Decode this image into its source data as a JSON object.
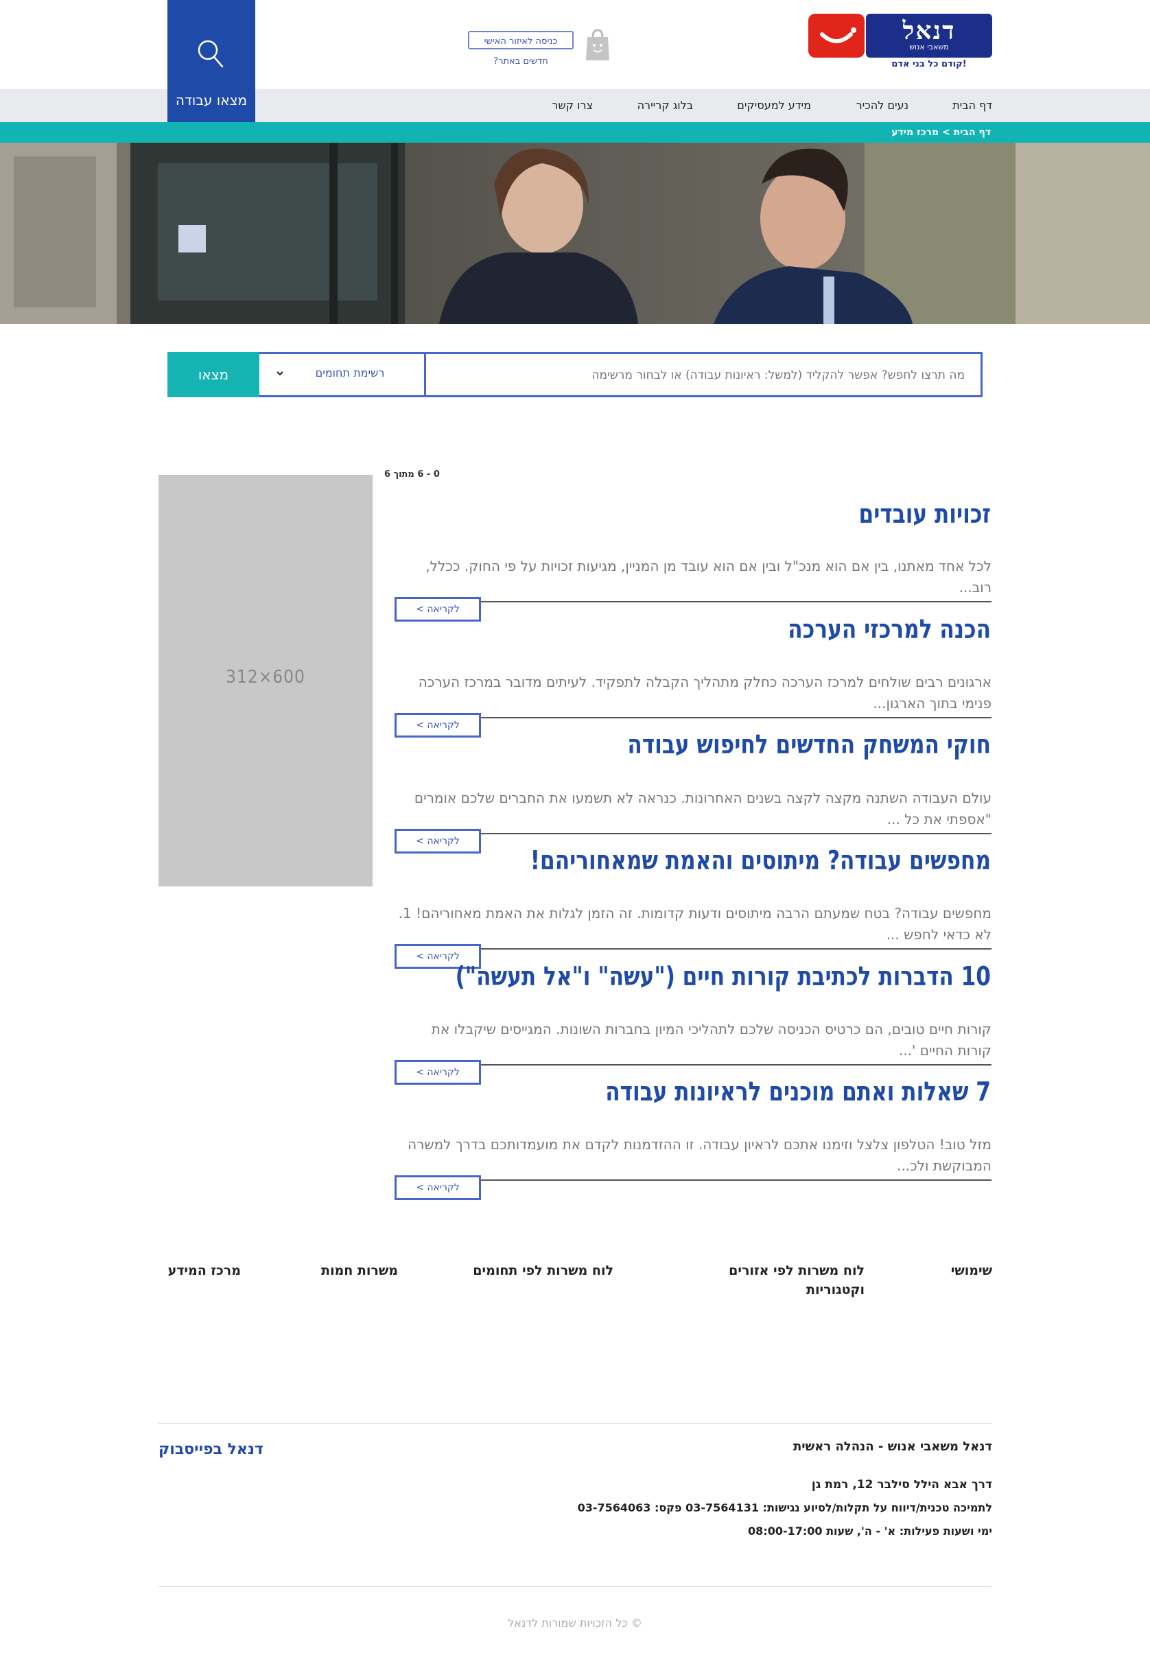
{
  "header": {
    "logo_text": "דנאל",
    "logo_subtitle": "משאבי אנוש",
    "logo_tagline": "קודם כל בני אדם!",
    "login_label": "כניסה לאיזור האישי",
    "new_link": "חדשים באתר?",
    "find_job_label": "מצאו עבודה"
  },
  "nav": {
    "items": [
      "דף הבית",
      "נעים להכיר",
      "מידע למעסיקים",
      "בלוג קריירה",
      "צרו קשר"
    ]
  },
  "breadcrumb": "דף הבית > מרכז מידע",
  "search": {
    "placeholder": "מה תרצו לחפש? אפשר להקליד (למשל: ראיונות עבודה) או לבחור מרשימה",
    "category_label": "רשימת תחומים",
    "button_label": "מצאו"
  },
  "results_count": "0 - 6 מתוך 6",
  "ad_label": "312×600",
  "articles": [
    {
      "title": "זכויות עובדים",
      "excerpt": "לכל אחד מאתנו, בין אם הוא מנכ\"ל ובין אם הוא עובד מן המניין, מגיעות זכויות על פי החוק. ככלל, רוב...",
      "button": "לקריאה >"
    },
    {
      "title": "הכנה למרכזי הערכה",
      "excerpt": "ארגונים רבים שולחים למרכז הערכה כחלק מתהליך הקבלה לתפקיד. לעיתים מדובר במרכז הערכה פנימי בתוך הארגון...",
      "button": "לקריאה >"
    },
    {
      "title": "חוקי המשחק החדשים לחיפוש עבודה",
      "excerpt": "עולם העבודה השתנה מקצה לקצה בשנים האחרונות. כנראה לא תשמעו את החברים שלכם אומרים \"אספתי את כל ...",
      "button": "לקריאה >"
    },
    {
      "title": "מחפשים עבודה? מיתוסים והאמת שמאחוריהם!",
      "excerpt": "מחפשים עבודה? בטח שמעתם הרבה מיתוסים ודעות קדומות. זה הזמן לגלות את האמת מאחוריהם! 1. לא כדאי לחפש ...",
      "button": "לקריאה >"
    },
    {
      "title": "10 הדברות לכתיבת קורות חיים (\"עשה\" ו\"אל תעשה\")",
      "excerpt": "קורות חיים טובים, הם כרטיס הכניסה שלכם לתהליכי המיון בחברות השונות. המגייסים שיקבלו את קורות החיים '...",
      "button": "לקריאה >"
    },
    {
      "title": "7 שאלות ואתם מוכנים לראיונות עבודה",
      "excerpt": "מזל טוב! הטלפון צלצל וזימנו אתכם לראיון עבודה. זו ההזדמנות לקדם את מועמדותכם בדרך למשרה המבוקשת ולכ...",
      "button": "לקריאה >"
    }
  ],
  "footer": {
    "links": [
      "שימושי",
      "לוח משרות לפי אזורים וקטגוריות",
      "לוח משרות לפי תחומים",
      "משרות חמות",
      "מרכז המידע"
    ],
    "company_name": "דנאל משאבי אנוש - הנהלה ראשית",
    "address": "דרך אבא הילל סילבר 12, רמת גן",
    "support": "לתמיכה טכנית/דיווח על תקלות/לסיוע נגישות: 03-7564131 פקס: 03-7564063",
    "hours": "ימי ושעות פעילות: א' - ה', שעות 08:00-17:00",
    "facebook": "דנאל בפייסבוק",
    "copyright": "© כל הזכויות שמורות לדנאל"
  },
  "colors": {
    "brand_blue": "#1e4aa8",
    "teal": "#16b3b3",
    "logo_red": "#e1251b",
    "nav_bg": "#e8eaed"
  }
}
